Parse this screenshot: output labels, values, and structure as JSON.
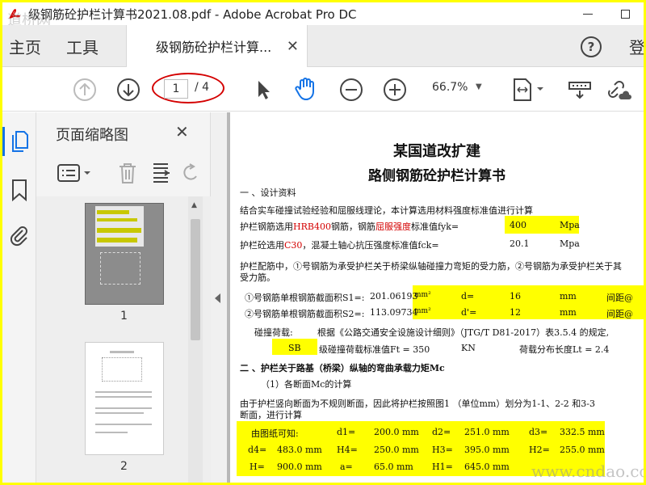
{
  "window": {
    "title": "级钢筋砼护栏计算书2021.08.pdf - Adobe Acrobat Pro DC"
  },
  "tabs": {
    "home": "主页",
    "tools": "工具",
    "document": "级钢筋砼护栏计算...",
    "login": "登"
  },
  "toolbar": {
    "current_page": "1",
    "total_pages": "/ 4",
    "zoom": "66.7%"
  },
  "thumbnails": {
    "title": "页面缩略图",
    "pages": [
      "1",
      "2"
    ]
  },
  "document": {
    "title1": "某国道改扩建",
    "title2": "路侧钢筋砼护栏计算书",
    "section1": "一 、设计资料",
    "intro": "结合实车碰撞试验经验和屈服线理论，本计算选用材料强度标准值进行计算",
    "steel_prefix": "护栏钢筋选用",
    "steel_grade": "HRB400",
    "steel_mid": "钢筋，钢筋",
    "steel_yield": "屈服强度",
    "steel_suffix": "标准值fyk=",
    "steel_value": "400",
    "steel_unit": "Mpa",
    "conc_prefix": "护栏砼选用",
    "conc_grade": "C30",
    "conc_suffix": "，混凝土轴心抗压强度标准值fck=",
    "conc_value": "20.1",
    "conc_unit": "Mpa",
    "rebar_desc1": "护栏配筋中，①号钢筋为承受护栏关于桥梁纵轴碰撞力弯矩的受力筋，②号钢筋为承受护栏关于其",
    "rebar_desc2": "受力筋。",
    "s1_label": "①号钢筋单根钢筋截面积S1=:",
    "s1_value": "201.06193",
    "s1_unit": "mm²",
    "s1_d_label": "d=",
    "s1_d_value": "16",
    "s1_d_unit": "mm",
    "s1_spacing": "间距@",
    "s2_label": "②号钢筋单根钢筋截面积S2=:",
    "s2_value": "113.09734",
    "s2_unit": "mm²",
    "s2_d_label": "d'=",
    "s2_d_value": "12",
    "s2_d_unit": "mm",
    "s2_spacing": "间距@",
    "collision_label": "碰撞荷载:",
    "collision_text": "根据《公路交通安全设施设计细则》（JTG/T D81-2017）表3.5.4 的规定,",
    "sb_value": "SB",
    "ft_text": "级碰撞荷载标准值Ft = 350",
    "ft_unit": "KN",
    "lt_text": "荷载分布长度Lt =   2.4",
    "section2": "二 、护栏关于路基（桥梁）纵轴的弯曲承载力矩Mc",
    "sub1": "（1）各断面Mc的计算",
    "para1": "由于护栏竖向断面为不规则断面，因此将护栏按照图1 （单位mm）划分为1-1、2-2 和3-3",
    "para2": "断面，进行计算",
    "dims": {
      "r1": [
        "由图纸可知:",
        "d1=",
        "200.0 mm",
        "d2=",
        "251.0 mm",
        "d3=",
        "332.5 mm"
      ],
      "r2": [
        "d4=",
        "483.0 mm",
        "H4=",
        "250.0 mm",
        "H3=",
        "395.0 mm",
        "H2=",
        "255.0 mm"
      ],
      "r3": [
        "H=",
        "900.0 mm",
        "a=",
        "65.0 mm",
        "H1=",
        "645.0 mm"
      ]
    }
  },
  "watermark": "www.cndao.com",
  "watermark_left": "道桥网",
  "colors": {
    "highlight": "#ffff00",
    "annotation_red": "#d40000",
    "accent_blue": "#1473e6"
  }
}
